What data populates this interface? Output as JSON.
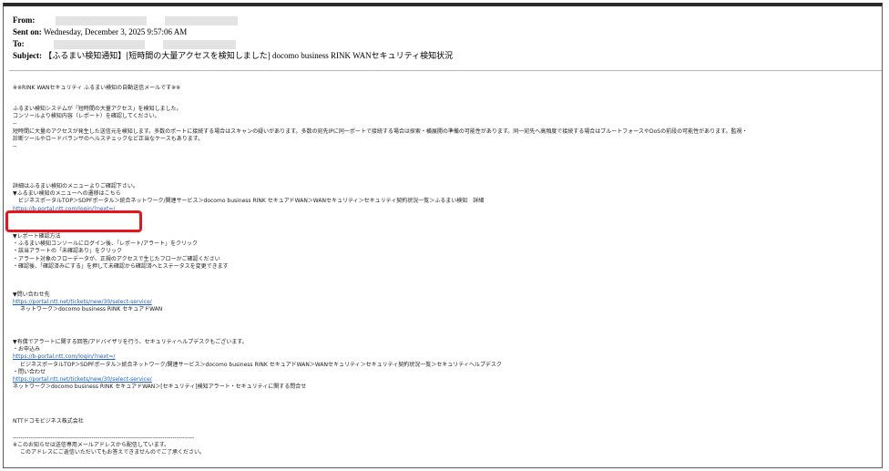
{
  "header": {
    "from_label": "From:",
    "sent_label": "Sent on:",
    "sent_value": "Wednesday, December 3, 2025 9:57:06 AM",
    "to_label": "To:",
    "subject_label": "Subject:",
    "subject_value": "【ふるまい検知通知】[短時間の大量アクセスを検知しました] docomo business RINK WANセキュリティ検知状況"
  },
  "body": {
    "intro": "※※RINK WANセキュリティ ふるまい検知の自動送信メールです※※",
    "p1": "ふるまい検知システムが「短時間の大量アクセス」を検知しました。",
    "p2": "コンソールより検知内容（レポート）を確認してください。",
    "dash1": "--",
    "desc": "短時間に大量のアクセスが発生した送信元を検知します。多数のポートに接続する場合はスキャンの疑いがあります。多数の宛先IPに同一ポートで接続する場合は探索・横展開の準備の可能性があります。同一宛先へ高頻度で接続する場合はブルートフォースやDoSの前段の可能性があります。監視・",
    "desc2": "診断ツールやロードバランサのヘルスチェックなど正当なケースもあります。",
    "dash2": "--",
    "detail": "詳細はふるまい検知のメニューよりご確認下さい。",
    "menu_title": "▼ふるまい検知のメニューへの遷移はこちら",
    "menu_path": "ビジネスポータルTOP＞SDPFポータル＞統合ネットワーク/関連サービス＞docomo business RINK セキュアドWAN＞WANセキュリティ＞セキュリティ契約状況一覧＞ふるまい検知　詳細",
    "menu_link": "https://b-portal.ntt.com/login/?next=/",
    "report_title": "▼レポート確認方法",
    "report_steps": [
      "・ふるまい検知コンソールにログイン後、「レポート/アラート」をクリック",
      "・該当アラートの「未確認あり」をクリック",
      "・アラート対象のフローデータが、正規のアクセスで生じたフローかご確認ください",
      "・確認後、「確認済みにする」を押して未確認から確認済へとステータスを変更できます"
    ],
    "contact_title": "▼問い合わせ先",
    "contact_link": "https://portal.ntt.net/tickets/new/30/select-service/",
    "contact_path": "ネットワーク＞docomo business RINK セキュアドWAN",
    "paid_title": "▼有償でアラートに関する回答/アドバイザリを行う、セキュリティヘルプデスクもございます。",
    "apply_label": "・お申込み",
    "apply_link": "https://b-portal.ntt.com/login/?next=/",
    "apply_path": "ビジネスポータルTOP＞SDPFポータル＞統合ネットワーク/関連サービス＞docomo business RINK セキュアドWAN＞WANセキュリティ＞セキュリティ契約状況一覧＞セキュリティヘルプデスク",
    "inquiry_label": "・問い合わせ",
    "inquiry_link": "https://portal.ntt.net/tickets/new/30/select-service/",
    "inquiry_path": "ネットワーク＞docomo business RINK セキュアドWAN＞[セキュリティ]検知アラート・セキュリティに関する問合せ",
    "company": "NTTドコモビジネス株式会社",
    "rule": "--------------------------------------------------------------------------------------------",
    "footer1": "※このお知らせは送信専用メールアドレスから配信しています。",
    "footer2": "このアドレスにご返信いただいてもお答えできませんのでご了承ください。"
  },
  "colors": {
    "link": "#1f5fbf",
    "highlight": "#e8141b",
    "redaction": "#e3e3e3"
  }
}
